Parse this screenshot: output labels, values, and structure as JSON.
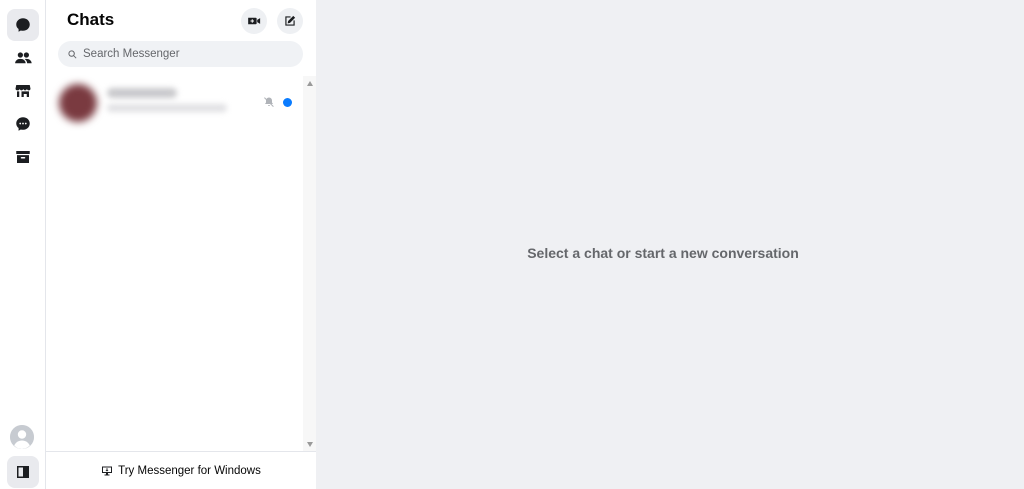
{
  "sidebar": {
    "title": "Chats",
    "search": {
      "placeholder": "Search Messenger",
      "value": ""
    },
    "footer_label": "Try Messenger for Windows",
    "conversations": [
      {
        "name": "",
        "preview": "",
        "muted": true,
        "unread": true
      }
    ]
  },
  "main": {
    "empty_state": "Select a chat or start a new conversation"
  },
  "colors": {
    "accent": "#0a7cff",
    "main_bg": "#eff0f3",
    "muted_text": "#65676b"
  },
  "icons": {
    "rail": [
      "chats-icon",
      "people-icon",
      "marketplace-icon",
      "message-requests-icon",
      "archive-icon"
    ],
    "header": [
      "new-video-call-icon",
      "compose-icon"
    ]
  }
}
